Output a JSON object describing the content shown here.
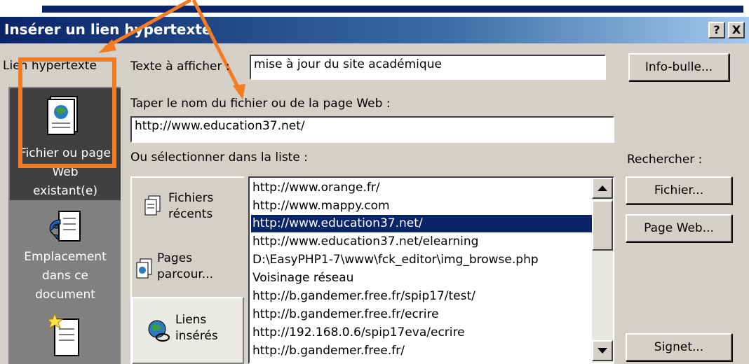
{
  "window": {
    "title": "Insérer un lien hypertexte",
    "help_glyph": "?",
    "close_glyph": "X"
  },
  "places_bar": {
    "header": "Lien hypertexte",
    "items": [
      {
        "label": "Fichier ou page Web existant(e)",
        "icon": "web-page-file-icon",
        "selected": true
      },
      {
        "label": "Emplacement dans ce document",
        "icon": "document-location-icon",
        "selected": false
      },
      {
        "label": "",
        "icon": "new-document-icon",
        "selected": false
      }
    ]
  },
  "display_text": {
    "label": "Texte à afficher :",
    "value": "mise à jour du site académique"
  },
  "tooltip_button": "Info-bulle...",
  "address": {
    "label": "Taper le nom du fichier ou de la page Web :",
    "value": "http://www.education37.net/"
  },
  "list_label": "Ou sélectionner dans la liste :",
  "browse_label": "Rechercher :",
  "browse_buttons": {
    "file": "Fichier...",
    "web_page": "Page Web...",
    "bookmark": "Signet..."
  },
  "sub_places": [
    {
      "line1": "Fichiers",
      "line2": "récents",
      "icon": "recent-files-icon",
      "selected": false
    },
    {
      "line1": "Pages",
      "line2": "parcour...",
      "icon": "browsed-pages-icon",
      "selected": false
    },
    {
      "line1": "Liens",
      "line2": "insérés",
      "icon": "inserted-links-icon",
      "selected": true
    }
  ],
  "list_items": [
    "http://www.orange.fr/",
    "http://www.mappy.com",
    "http://www.education37.net/",
    "http://www.education37.net/elearning",
    "D:\\EasyPHP1-7\\www\\fck_editor\\img_browse.php",
    "Voisinage réseau",
    "http://b.gandemer.free.fr/spip17/test/",
    "http://b.gandemer.free.fr/ecrire",
    "http://192.168.0.6/spip17eva/ecrire",
    "http://b.gandemer.free.fr/"
  ],
  "selected_list_index": 2,
  "colors": {
    "dialog_bg": "#d4d0c8",
    "title_bar": "#0a246a",
    "selection": "#0a246a",
    "annotation": "#f47b20"
  }
}
